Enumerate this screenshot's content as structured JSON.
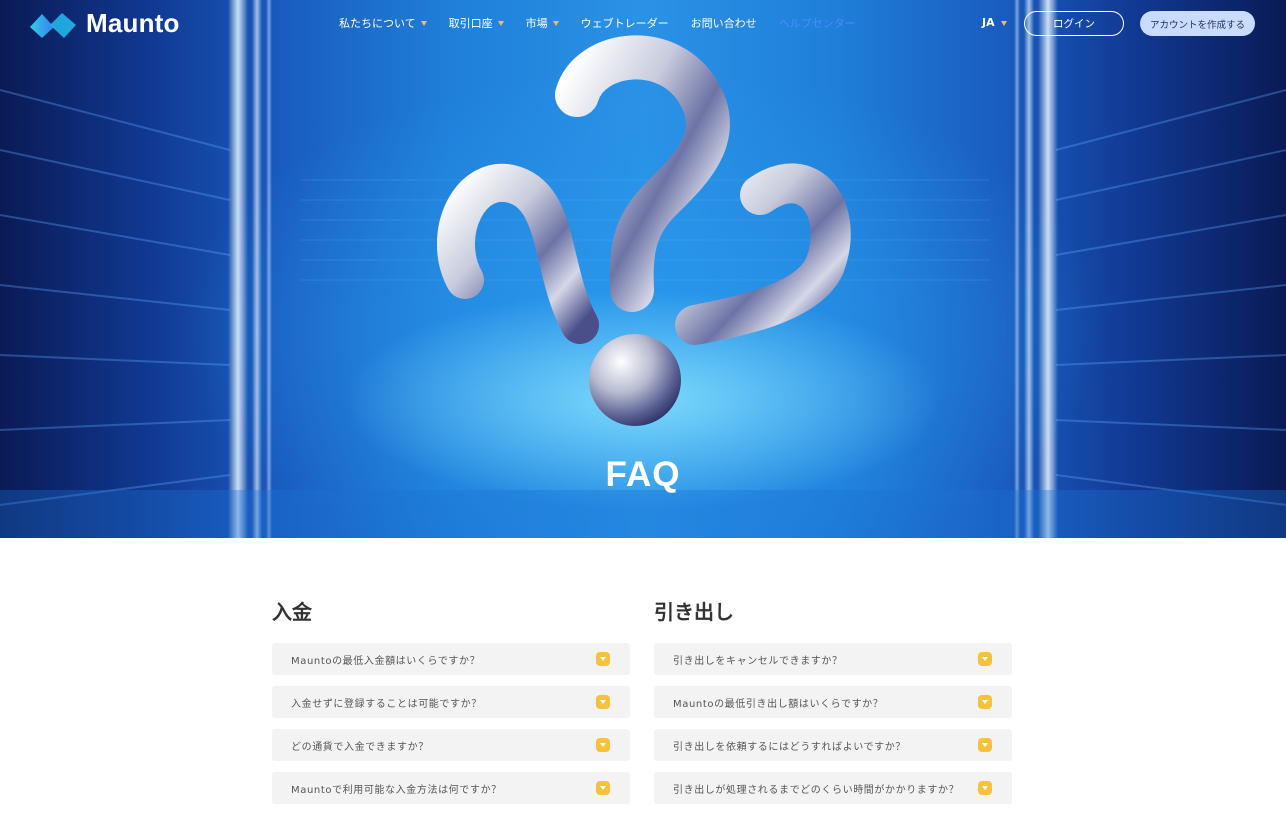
{
  "brand": {
    "name": "Maunto"
  },
  "nav": {
    "items": [
      {
        "label": "私たちについて",
        "dropdown": true
      },
      {
        "label": "取引口座",
        "dropdown": true
      },
      {
        "label": "市場",
        "dropdown": true
      },
      {
        "label": "ウェブトレーダー",
        "dropdown": false
      },
      {
        "label": "お問い合わせ",
        "dropdown": false
      },
      {
        "label": "ヘルプセンター",
        "dropdown": false,
        "active": true
      }
    ],
    "language": "JA",
    "login_label": "ログイン",
    "signup_label": "アカウントを作成する"
  },
  "hero": {
    "title": "FAQ"
  },
  "faq": {
    "deposit": {
      "heading": "入金",
      "questions": [
        "Mauntoの最低入金額はいくらですか？",
        "入金せずに登録することは可能ですか？",
        "どの通貨で入金できますか？",
        "Mauntoで利用可能な入金方法は何ですか？"
      ]
    },
    "withdrawal": {
      "heading": "引き出し",
      "questions": [
        "引き出しをキャンセルできますか？",
        "Mauntoの最低引き出し額はいくらですか？",
        "引き出しを依頼するにはどうすればよいですか？",
        "引き出しが処理されるまでどのくらい時間がかかりますか？"
      ]
    }
  },
  "colors": {
    "accent_yellow": "#f6c23e",
    "active_nav": "#4a8bff",
    "signup_bg": "#c9dcff",
    "faq_item_bg": "#f3f3f3"
  }
}
